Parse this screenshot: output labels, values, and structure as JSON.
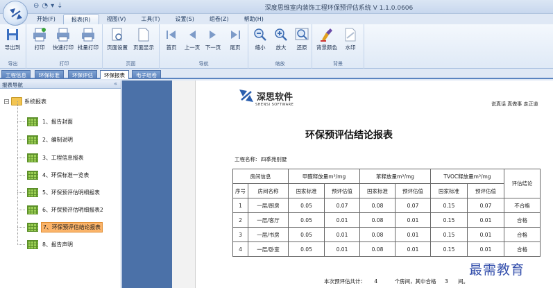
{
  "app": {
    "title": "深度思维室内装饰工程环保预评估系统  V 1.1.0.0606"
  },
  "quick_access": {
    "items": [
      "⊖",
      "◔",
      "▾",
      "⇣"
    ]
  },
  "menu": [
    "开始(F)",
    "报表(R)",
    "视图(V)",
    "工具(T)",
    "设置(S)",
    "组卷(Z)",
    "帮助(H)"
  ],
  "ribbon": {
    "groups": [
      {
        "label": "导出",
        "buttons": [
          "导出到"
        ]
      },
      {
        "label": "打印",
        "buttons": [
          "打印",
          "快速打印",
          "批量打印"
        ]
      },
      {
        "label": "页面",
        "buttons": [
          "页面设置",
          "页面显示"
        ]
      },
      {
        "label": "导航",
        "buttons": [
          "首页",
          "上一页",
          "下一页",
          "尾页"
        ]
      },
      {
        "label": "缩放",
        "buttons": [
          "缩小",
          "放大",
          "还原"
        ]
      },
      {
        "label": "背景",
        "buttons": [
          "背景颜色",
          "水印"
        ]
      }
    ]
  },
  "doc_tabs": [
    "工程信息",
    "环保标准",
    "环保评估",
    "环保报表",
    "电子组卷"
  ],
  "nav": {
    "header": "报表导航",
    "collapse_glyph": "«",
    "root": "系统报表",
    "items": [
      "1、报告封面",
      "2、编制说明",
      "3、工程信息报表",
      "4、环保标准一览表",
      "5、环保预评估明细报表",
      "6、环保预评估明细报表2",
      "7、环保预评估结论报表",
      "8、报告声明"
    ]
  },
  "report": {
    "company_name": "深思软件",
    "company_en": "SHENSI SOFTWARE",
    "slogan": "说真话  真做事  走正道",
    "title": "环保预评估结论报表",
    "project_label": "工程名称:",
    "project_name": "四季苑别墅",
    "col_room": "房间信息",
    "col_formaldehyde": "甲醛释放量m³/mg",
    "col_benzene": "苯释放量m³/mg",
    "col_tvoc": "TVOC释放量m³/mg",
    "col_conclusion": "评估结论",
    "sub_no": "序号",
    "sub_name": "房间名称",
    "sub_std": "国家标准",
    "sub_est": "预评估值",
    "rows": [
      {
        "no": "1",
        "room": "一层/厨房",
        "f_std": "0.05",
        "f_est": "0.07",
        "b_std": "0.08",
        "b_est": "0.07",
        "t_std": "0.15",
        "t_est": "0.07",
        "result": "不合格"
      },
      {
        "no": "2",
        "room": "一层/客厅",
        "f_std": "0.05",
        "f_est": "0.01",
        "b_std": "0.08",
        "b_est": "0.01",
        "t_std": "0.15",
        "t_est": "0.01",
        "result": "合格"
      },
      {
        "no": "3",
        "room": "一层/书房",
        "f_std": "0.05",
        "f_est": "0.01",
        "b_std": "0.08",
        "b_est": "0.01",
        "t_std": "0.15",
        "t_est": "0.01",
        "result": "合格"
      },
      {
        "no": "4",
        "room": "一层/卧室",
        "f_std": "0.05",
        "f_est": "0.01",
        "b_std": "0.08",
        "b_est": "0.01",
        "t_std": "0.15",
        "t_est": "0.01",
        "result": "合格"
      }
    ],
    "summary_prefix": "本次预评估共计：",
    "summary_total": "4",
    "summary_mid": "个房间，其中合格",
    "summary_pass": "3",
    "summary_suffix": "间。"
  },
  "watermark": "最需教育",
  "colors": {
    "accent": "#4b71a8",
    "selected": "#fbb46a",
    "tree_icon": "#9ccf55"
  }
}
